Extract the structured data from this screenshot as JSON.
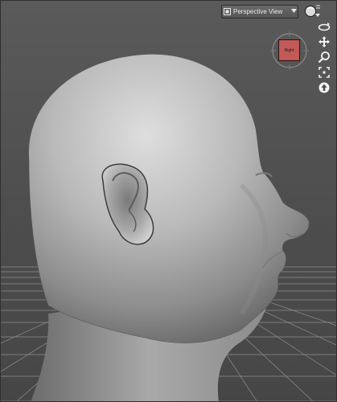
{
  "viewport": {
    "view_label": "Perspective View",
    "nav_cube_label": "Right"
  },
  "icons": {
    "camera": "camera-icon",
    "dropdown": "chevron-down-icon",
    "render": "render-sphere-icon",
    "orbit": "orbit-icon",
    "pan": "pan-icon",
    "zoom": "zoom-icon",
    "frame": "frame-icon",
    "reset": "reset-view-icon"
  },
  "colors": {
    "background": "#4a4a4a",
    "grid": "#9a9a9a",
    "nav_cube": "#c25a58",
    "model": "#9c9c9c"
  }
}
